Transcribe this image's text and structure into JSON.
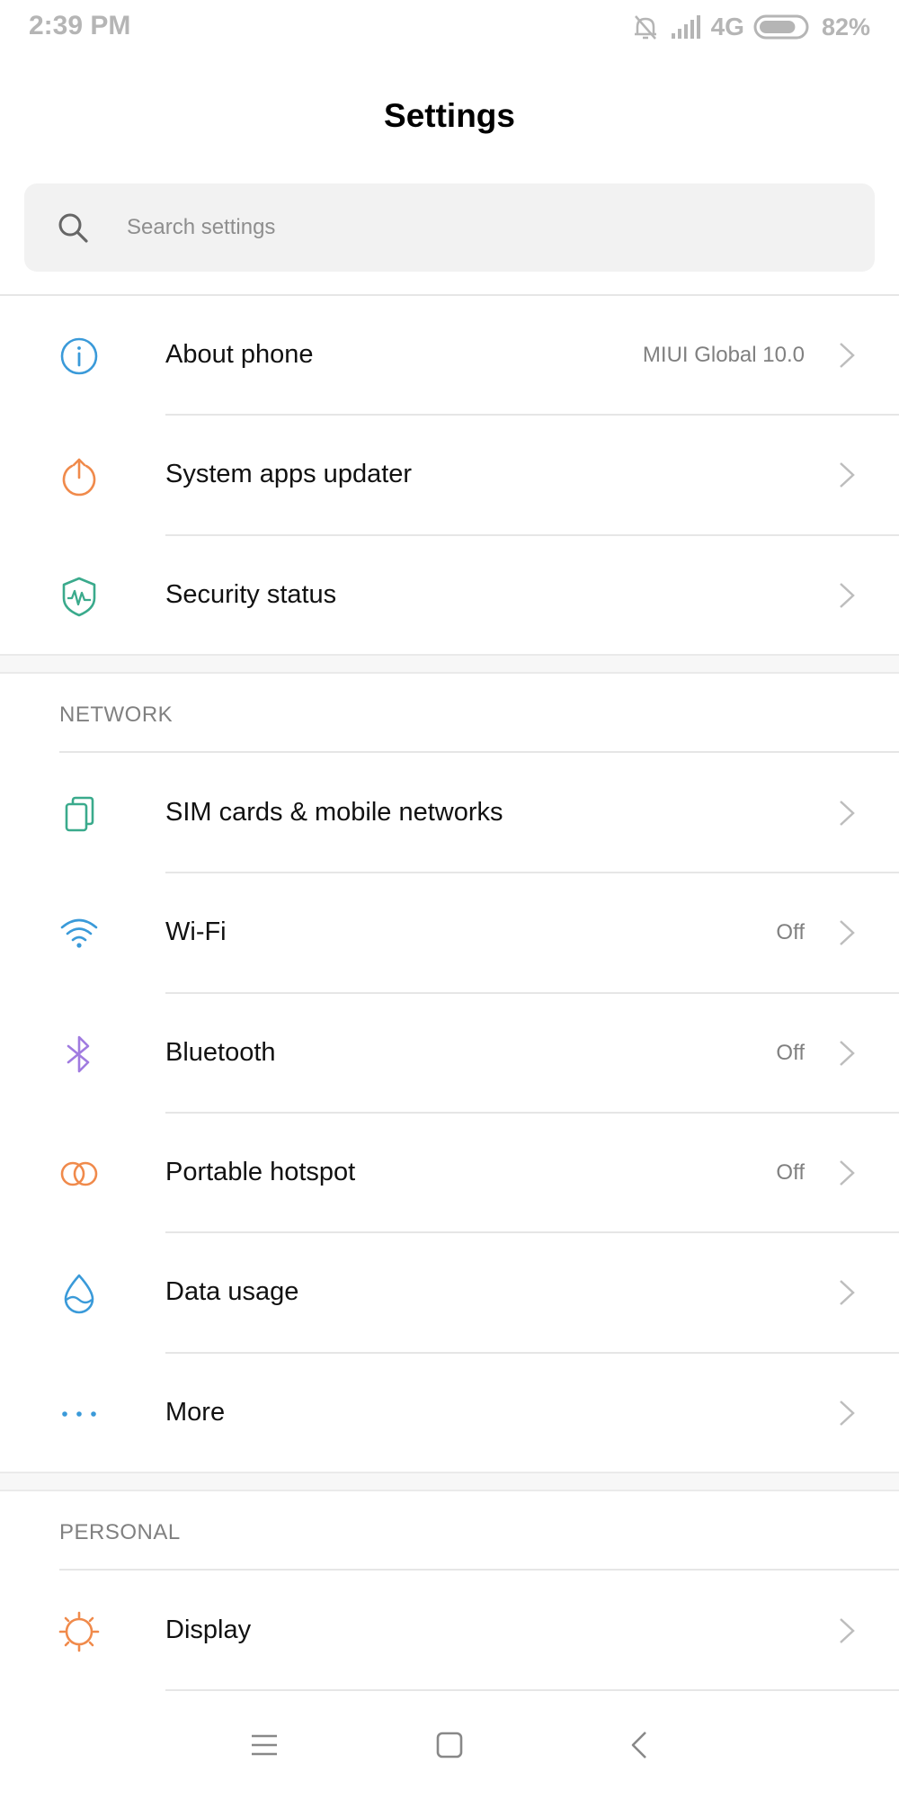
{
  "status_bar": {
    "time": "2:39 PM",
    "network": "4G",
    "battery": "82%",
    "battery_level": 0.82,
    "icons": [
      "mute-icon",
      "signal-icon",
      "battery-icon"
    ]
  },
  "header": {
    "title": "Settings"
  },
  "search": {
    "placeholder": "Search settings"
  },
  "top_items": [
    {
      "label": "About phone",
      "value": "MIUI Global 10.0",
      "icon": "info-icon",
      "color": "#3a9ad9"
    },
    {
      "label": "System apps updater",
      "value": "",
      "icon": "upload-icon",
      "color": "#f08a4b"
    },
    {
      "label": "Security status",
      "value": "",
      "icon": "shield-icon",
      "color": "#3aaa8c"
    }
  ],
  "network": {
    "header": "NETWORK",
    "items": [
      {
        "label": "SIM cards & mobile networks",
        "value": "",
        "icon": "sim-icon",
        "color": "#3aaa8c"
      },
      {
        "label": "Wi-Fi",
        "value": "Off",
        "icon": "wifi-icon",
        "color": "#3a9ad9"
      },
      {
        "label": "Bluetooth",
        "value": "Off",
        "icon": "bluetooth-icon",
        "color": "#a07be0"
      },
      {
        "label": "Portable hotspot",
        "value": "Off",
        "icon": "hotspot-icon",
        "color": "#f08a4b"
      },
      {
        "label": "Data usage",
        "value": "",
        "icon": "drop-icon",
        "color": "#3a9ad9"
      },
      {
        "label": "More",
        "value": "",
        "icon": "more-icon",
        "color": "#3a9ad9"
      }
    ]
  },
  "personal": {
    "header": "PERSONAL",
    "items": [
      {
        "label": "Display",
        "value": "",
        "icon": "sun-icon",
        "color": "#f08a4b"
      }
    ]
  },
  "nav_bar": {
    "buttons": [
      "menu-icon",
      "home-icon",
      "back-icon"
    ]
  }
}
